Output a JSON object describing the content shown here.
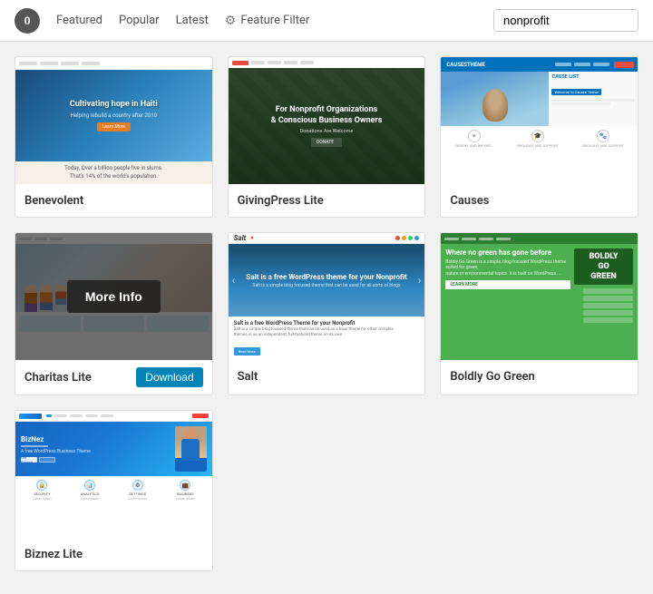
{
  "topbar": {
    "counter": "0",
    "nav": {
      "featured": "Featured",
      "popular": "Popular",
      "latest": "Latest",
      "feature_filter": "Feature Filter"
    },
    "search_placeholder": "nonprofit",
    "search_value": "nonprofit"
  },
  "themes": [
    {
      "id": "benevolent",
      "name": "Benevolent",
      "hero_title": "Cultivating hope in Haiti",
      "hero_sub": "Helping rebuild a country after 2010",
      "body_text": "Today, Over a billion people live in slums.\nThat's 14% of the world's population.",
      "has_overlay": false,
      "has_download": false
    },
    {
      "id": "givingpress",
      "name": "GivingPress Lite",
      "hero_title": "For Nonprofit Organizations & Conscious Business Owners",
      "hero_sub": "Donations Are Welcome",
      "has_overlay": false,
      "has_download": false
    },
    {
      "id": "causes",
      "name": "Causes",
      "has_overlay": false,
      "has_download": false
    },
    {
      "id": "charitas",
      "name": "Charitas Lite",
      "has_overlay": true,
      "overlay_text": "More Info",
      "has_download": true,
      "download_label": "Download"
    },
    {
      "id": "salt",
      "name": "Salt",
      "hero_title": "Salt is a free WordPress theme for your Nonprofit",
      "has_overlay": false,
      "has_download": false
    },
    {
      "id": "boldly",
      "name": "Boldly Go Green",
      "hero_title": "Where no green has gone before",
      "has_overlay": false,
      "has_download": false
    },
    {
      "id": "biznez",
      "name": "Biznez Lite",
      "has_overlay": false,
      "has_download": false
    }
  ],
  "icons": {
    "gear": "⚙",
    "heart": "♥",
    "graduation": "🎓",
    "paw": "🐾",
    "star": "★",
    "arrow_left": "‹",
    "arrow_right": "›"
  }
}
